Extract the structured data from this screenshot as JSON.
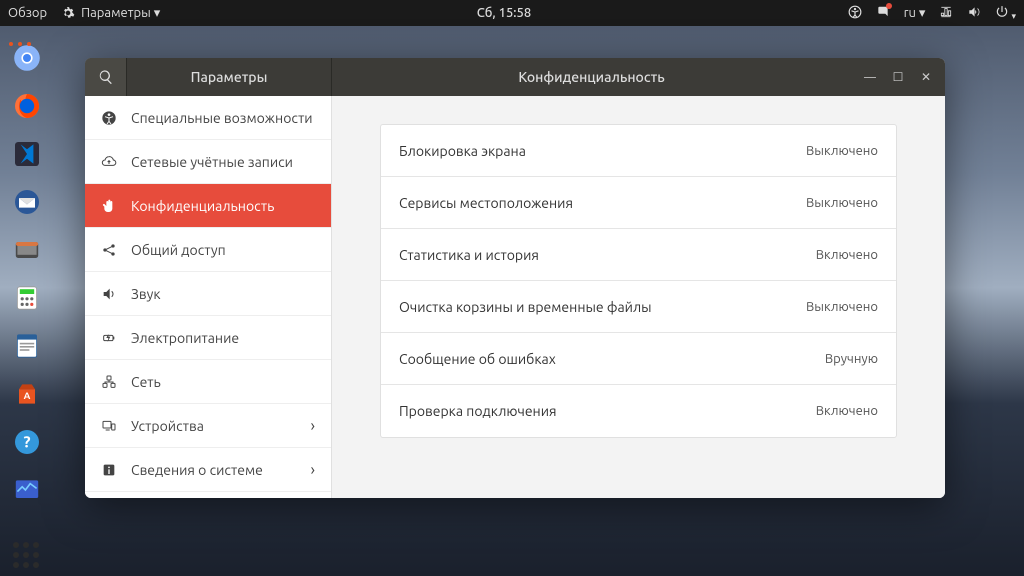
{
  "topbar": {
    "overview": "Обзор",
    "appmenu": "Параметры ▾",
    "clock": "Сб, 15:58",
    "lang": "ru ▾"
  },
  "window": {
    "sidebar_title": "Параметры",
    "main_title": "Конфиденциальность"
  },
  "sidebar": {
    "items": [
      {
        "label": "Специальные возможности",
        "icon": "accessibility",
        "chevron": false,
        "selected": false
      },
      {
        "label": "Сетевые учётные записи",
        "icon": "cloud-sync",
        "chevron": false,
        "selected": false
      },
      {
        "label": "Конфиденциальность",
        "icon": "hand",
        "chevron": false,
        "selected": true
      },
      {
        "label": "Общий доступ",
        "icon": "share",
        "chevron": false,
        "selected": false
      },
      {
        "label": "Звук",
        "icon": "sound",
        "chevron": false,
        "selected": false
      },
      {
        "label": "Электропитание",
        "icon": "power",
        "chevron": false,
        "selected": false
      },
      {
        "label": "Сеть",
        "icon": "network",
        "chevron": false,
        "selected": false
      },
      {
        "label": "Устройства",
        "icon": "devices",
        "chevron": true,
        "selected": false
      },
      {
        "label": "Сведения о системе",
        "icon": "info",
        "chevron": true,
        "selected": false
      }
    ]
  },
  "content": {
    "rows": [
      {
        "label": "Блокировка экрана",
        "value": "Выключено"
      },
      {
        "label": "Сервисы местоположения",
        "value": "Выключено"
      },
      {
        "label": "Статистика и история",
        "value": "Включено"
      },
      {
        "label": "Очистка корзины и временные файлы",
        "value": "Выключено"
      },
      {
        "label": "Сообщение об ошибках",
        "value": "Вручную"
      },
      {
        "label": "Проверка подключения",
        "value": "Включено"
      }
    ]
  }
}
